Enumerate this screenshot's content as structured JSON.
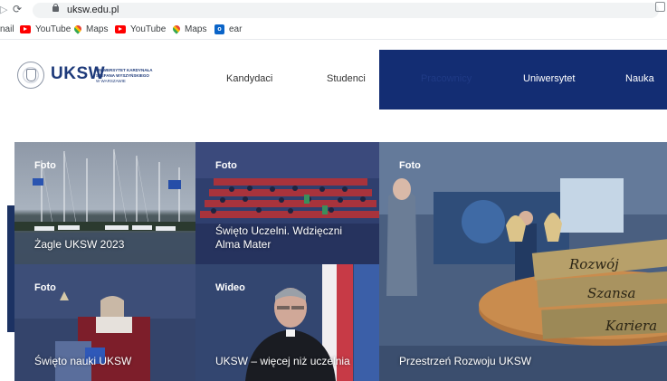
{
  "browser": {
    "url": "uksw.edu.pl",
    "bookmarks": [
      {
        "label": "nail",
        "icon": "none"
      },
      {
        "label": "YouTube",
        "icon": "youtube-icon"
      },
      {
        "label": "Maps",
        "icon": "maps-icon"
      },
      {
        "label": "YouTube",
        "icon": "youtube-icon"
      },
      {
        "label": "Maps",
        "icon": "maps-icon"
      },
      {
        "label": "ear",
        "icon": "outlook-icon"
      }
    ]
  },
  "header": {
    "logo_word": "UKSW",
    "logo_lines": [
      "UNIWERSYTET KARDYNAŁA",
      "STEFANA WYSZYŃSKIEGO",
      "W WARSZAWIE"
    ],
    "menu": [
      "Kandydaci",
      "Studenci",
      "Pracownicy",
      "Uniwersytet",
      "Nauka"
    ]
  },
  "tiles": [
    {
      "kind": "Foto",
      "title": "Żagle UKSW 2023"
    },
    {
      "kind": "Foto",
      "title": "Święto Uczelni. Wdzięczni\nAlma Mater"
    },
    {
      "kind": "Foto",
      "title": "Święto nauki UKSW"
    },
    {
      "kind": "Wideo",
      "title": "UKSW – więcej niż uczelnia"
    },
    {
      "kind": "Foto",
      "title": "Przestrzeń Rozwoju UKSW"
    }
  ],
  "photo_signs": [
    "Rozwój",
    "Szansa",
    "Kariera"
  ],
  "colors": {
    "brand_navy": "#132d73",
    "logo_blue": "#1e3a7a"
  }
}
